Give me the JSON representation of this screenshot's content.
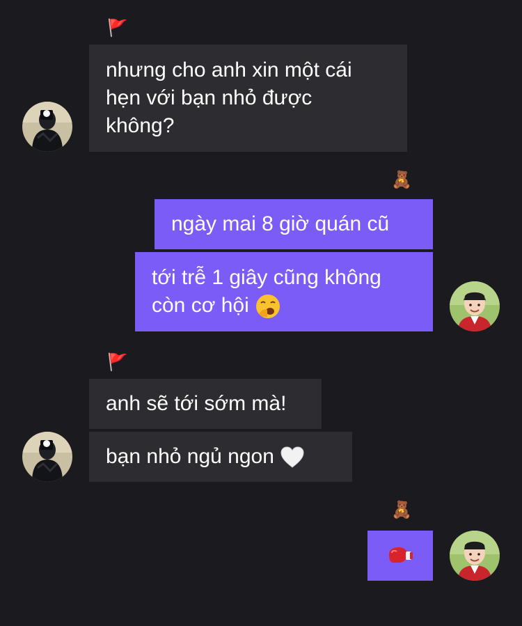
{
  "conversation": {
    "messages": [
      {
        "sender": "other",
        "text": "nhưng cho anh xin một cái\nhẹn với bạn nhỏ được\nkhông?"
      },
      {
        "sender": "me",
        "text": "ngày mai 8 giờ quán cũ"
      },
      {
        "sender": "me",
        "text": "tới trễ 1 giây cũng không\ncòn cơ hội ",
        "emoji": "yawning-face-emoji"
      },
      {
        "sender": "other",
        "text": "anh sẽ tới sớm mà!"
      },
      {
        "sender": "other",
        "text": "bạn nhỏ ngủ ngon ",
        "emoji": "white-heart-emoji"
      },
      {
        "sender": "me",
        "text": "",
        "emoji": "boxing-glove-emoji"
      }
    ],
    "reactions": {
      "other_group_marker": "🚩",
      "me_group_marker": "🧸"
    }
  },
  "colors": {
    "background": "#1b1a1f",
    "incoming_bubble": "#2d2c31",
    "outgoing_bubble": "#7c5cf6",
    "text": "#ffffff"
  },
  "icons": {
    "other_avatar": "avatar-dark-hoodie",
    "my_avatar": "avatar-child-red-shirt"
  }
}
